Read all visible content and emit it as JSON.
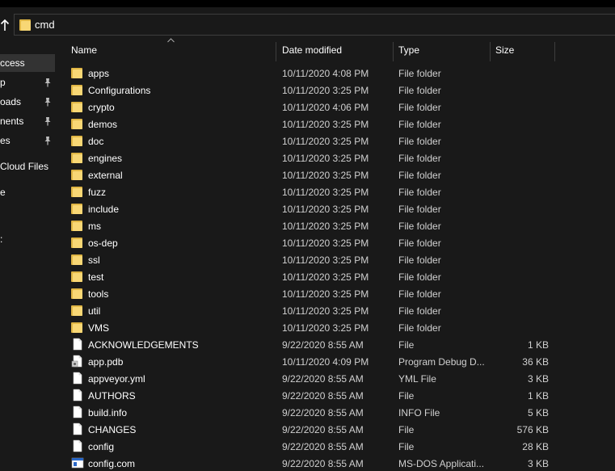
{
  "address": {
    "path": "cmd"
  },
  "nav": {
    "items": [
      {
        "label": "ccess",
        "pinned": false,
        "selected": true
      },
      {
        "label": "p",
        "pinned": true,
        "selected": false
      },
      {
        "label": "oads",
        "pinned": true,
        "selected": false
      },
      {
        "label": "nents",
        "pinned": true,
        "selected": false
      },
      {
        "label": "es",
        "pinned": true,
        "selected": false
      },
      {
        "label": " Cloud Files",
        "pinned": false,
        "selected": false
      },
      {
        "label": "e",
        "pinned": false,
        "selected": false
      },
      {
        "label": "",
        "pinned": false,
        "selected": false
      },
      {
        "label": ":",
        "pinned": false,
        "selected": false
      }
    ]
  },
  "columns": {
    "name": "Name",
    "date": "Date modified",
    "type": "Type",
    "size": "Size"
  },
  "files": [
    {
      "name": "apps",
      "date": "10/11/2020 4:08 PM",
      "type": "File folder",
      "size": "",
      "icon": "folder-icon"
    },
    {
      "name": "Configurations",
      "date": "10/11/2020 3:25 PM",
      "type": "File folder",
      "size": "",
      "icon": "folder-icon"
    },
    {
      "name": "crypto",
      "date": "10/11/2020 4:06 PM",
      "type": "File folder",
      "size": "",
      "icon": "folder-icon"
    },
    {
      "name": "demos",
      "date": "10/11/2020 3:25 PM",
      "type": "File folder",
      "size": "",
      "icon": "folder-icon"
    },
    {
      "name": "doc",
      "date": "10/11/2020 3:25 PM",
      "type": "File folder",
      "size": "",
      "icon": "folder-icon"
    },
    {
      "name": "engines",
      "date": "10/11/2020 3:25 PM",
      "type": "File folder",
      "size": "",
      "icon": "folder-icon"
    },
    {
      "name": "external",
      "date": "10/11/2020 3:25 PM",
      "type": "File folder",
      "size": "",
      "icon": "folder-icon"
    },
    {
      "name": "fuzz",
      "date": "10/11/2020 3:25 PM",
      "type": "File folder",
      "size": "",
      "icon": "folder-icon"
    },
    {
      "name": "include",
      "date": "10/11/2020 3:25 PM",
      "type": "File folder",
      "size": "",
      "icon": "folder-icon"
    },
    {
      "name": "ms",
      "date": "10/11/2020 3:25 PM",
      "type": "File folder",
      "size": "",
      "icon": "folder-icon"
    },
    {
      "name": "os-dep",
      "date": "10/11/2020 3:25 PM",
      "type": "File folder",
      "size": "",
      "icon": "folder-icon"
    },
    {
      "name": "ssl",
      "date": "10/11/2020 3:25 PM",
      "type": "File folder",
      "size": "",
      "icon": "folder-icon"
    },
    {
      "name": "test",
      "date": "10/11/2020 3:25 PM",
      "type": "File folder",
      "size": "",
      "icon": "folder-icon"
    },
    {
      "name": "tools",
      "date": "10/11/2020 3:25 PM",
      "type": "File folder",
      "size": "",
      "icon": "folder-icon"
    },
    {
      "name": "util",
      "date": "10/11/2020 3:25 PM",
      "type": "File folder",
      "size": "",
      "icon": "folder-icon"
    },
    {
      "name": "VMS",
      "date": "10/11/2020 3:25 PM",
      "type": "File folder",
      "size": "",
      "icon": "folder-icon"
    },
    {
      "name": "ACKNOWLEDGEMENTS",
      "date": "9/22/2020 8:55 AM",
      "type": "File",
      "size": "1 KB",
      "icon": "file-icon"
    },
    {
      "name": "app.pdb",
      "date": "10/11/2020 4:09 PM",
      "type": "Program Debug D...",
      "size": "36 KB",
      "icon": "pdb-file-icon"
    },
    {
      "name": "appveyor.yml",
      "date": "9/22/2020 8:55 AM",
      "type": "YML File",
      "size": "3 KB",
      "icon": "file-icon"
    },
    {
      "name": "AUTHORS",
      "date": "9/22/2020 8:55 AM",
      "type": "File",
      "size": "1 KB",
      "icon": "file-icon"
    },
    {
      "name": "build.info",
      "date": "9/22/2020 8:55 AM",
      "type": "INFO File",
      "size": "5 KB",
      "icon": "file-icon"
    },
    {
      "name": "CHANGES",
      "date": "9/22/2020 8:55 AM",
      "type": "File",
      "size": "576 KB",
      "icon": "file-icon"
    },
    {
      "name": "config",
      "date": "9/22/2020 8:55 AM",
      "type": "File",
      "size": "28 KB",
      "icon": "file-icon"
    },
    {
      "name": "config.com",
      "date": "9/22/2020 8:55 AM",
      "type": "MS-DOS Applicati...",
      "size": "3 KB",
      "icon": "dos-app-icon"
    }
  ],
  "colors": {
    "background": "#191919",
    "folder": "#f8d775",
    "folder_dark": "#e0b645",
    "text": "#ffffff",
    "muted_text": "#d0d0d0",
    "separator": "#3d3d3d"
  }
}
